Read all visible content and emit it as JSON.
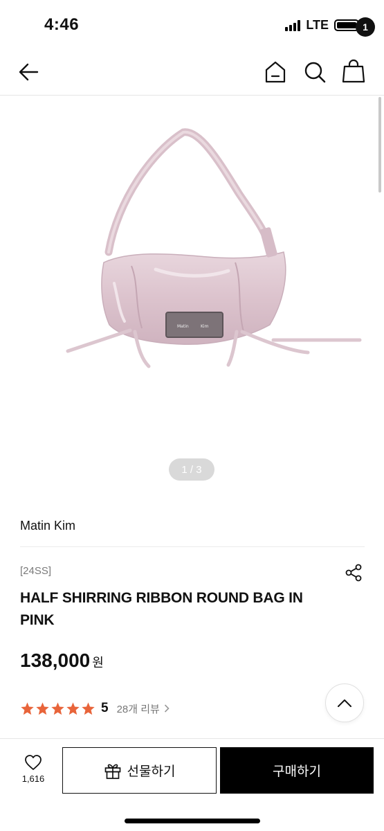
{
  "status": {
    "time": "4:46",
    "network": "LTE"
  },
  "nav": {
    "cart_count": "1"
  },
  "gallery": {
    "pager": "1 / 3",
    "plate_left": "Matin",
    "plate_right": "Kim"
  },
  "product": {
    "brand": "Matin Kim",
    "season": "[24SS]",
    "title": "HALF SHIRRING RIBBON ROUND BAG IN PINK",
    "price": "138,000",
    "currency": "원",
    "rating_score": "5",
    "rating_stars": 5,
    "review_label": "28개 리뷰"
  },
  "bottom": {
    "like_count": "1,616",
    "gift_label": "선물하기",
    "buy_label": "구매하기"
  },
  "colors": {
    "star": "#e8643a",
    "bag_pink": "#ddc5cf",
    "button_dark": "#000000"
  }
}
